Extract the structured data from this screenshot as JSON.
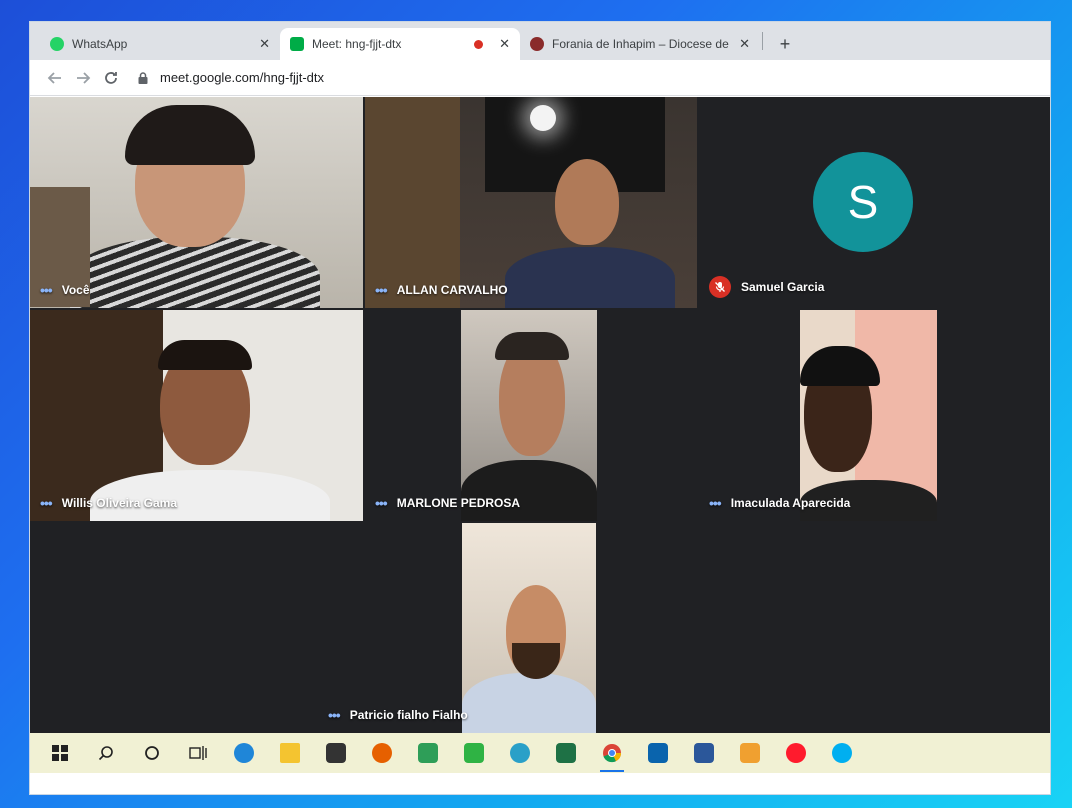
{
  "browser": {
    "tabs": [
      {
        "title": "WhatsApp",
        "favicon_color": "#25d366",
        "active": false,
        "recording": false
      },
      {
        "title": "Meet: hng-fjjt-dtx",
        "favicon_color": "#00ac47",
        "active": true,
        "recording": true
      },
      {
        "title": "Forania de Inhapim – Diocese de",
        "favicon_color": "#8a2b2b",
        "active": false,
        "recording": false
      }
    ],
    "close_glyph": "✕",
    "new_tab_glyph": "+",
    "url": "meet.google.com/hng-fjjt-dtx"
  },
  "meet": {
    "participants": [
      {
        "name": "Você",
        "muted": false,
        "has_video": true
      },
      {
        "name": "ALLAN CARVALHO",
        "muted": false,
        "has_video": true
      },
      {
        "name": "Samuel Garcia",
        "muted": true,
        "has_video": false,
        "avatar_letter": "S",
        "avatar_color": "#12939a"
      },
      {
        "name": "Willis Oliveira Gama",
        "muted": false,
        "has_video": true
      },
      {
        "name": "MARLONE PEDROSA",
        "muted": false,
        "has_video": true
      },
      {
        "name": "Imaculada Aparecida",
        "muted": false,
        "has_video": true
      },
      {
        "name": "Patricio fialho Fialho",
        "muted": false,
        "has_video": true
      }
    ],
    "more_glyph": "•••",
    "background_color": "#202124"
  },
  "taskbar": {
    "items": [
      {
        "icon": "windows-start-icon"
      },
      {
        "icon": "search-icon"
      },
      {
        "icon": "cortana-icon"
      },
      {
        "icon": "task-view-icon"
      },
      {
        "icon": "edge-icon"
      },
      {
        "icon": "file-explorer-icon"
      },
      {
        "icon": "store-icon"
      },
      {
        "icon": "firefox-icon"
      },
      {
        "icon": "photos-icon"
      },
      {
        "icon": "green-app-icon"
      },
      {
        "icon": "globe-app-icon"
      },
      {
        "icon": "excel-icon"
      },
      {
        "icon": "chrome-icon",
        "active": true
      },
      {
        "icon": "mail-icon"
      },
      {
        "icon": "word-icon"
      },
      {
        "icon": "media-player-icon"
      },
      {
        "icon": "opera-icon"
      },
      {
        "icon": "skype-icon"
      }
    ]
  },
  "colors": {
    "accent": "#1a73e8",
    "muted_red": "#d93025",
    "nameplate_dots": "#8ab4f8"
  }
}
